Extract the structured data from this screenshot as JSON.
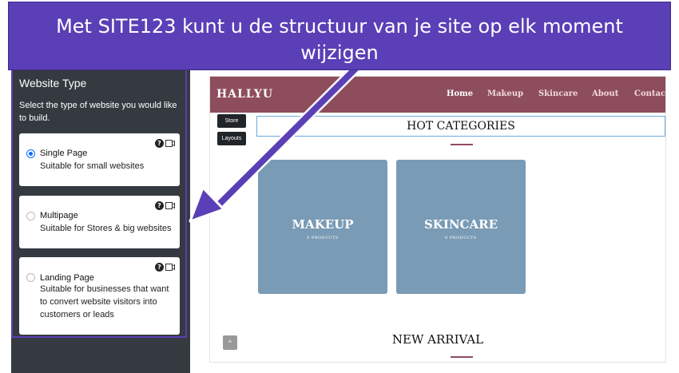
{
  "banner": {
    "line1": "Met SITE123 kunt u de structuur van je site op elk moment",
    "line2": "wijzigen"
  },
  "panel": {
    "title": "Website Type",
    "description": "Select the type of website you would like to build.",
    "options": [
      {
        "title": "Single Page",
        "description": "Suitable for small websites",
        "selected": true
      },
      {
        "title": "Multipage",
        "description": "Suitable for Stores & big websites",
        "selected": false
      },
      {
        "title": "Landing Page",
        "description": "Suitable for businesses that want to convert website visitors into customers or leads",
        "selected": false
      }
    ],
    "help_glyph": "?"
  },
  "site": {
    "logo": "HALLYU",
    "nav": [
      "Home",
      "Makeup",
      "Skincare",
      "About",
      "Contact"
    ],
    "side_buttons": [
      "Store",
      "Layouts"
    ],
    "hot_categories": "HOT CATEGORIES",
    "tiles": [
      {
        "name": "MAKEUP",
        "count": "0 PRODUCTS"
      },
      {
        "name": "SKINCARE",
        "count": "0 PRODUCTS"
      }
    ],
    "new_arrival": "NEW ARRIVAL",
    "scroll_top_glyph": "^"
  },
  "colors": {
    "banner": "#5b3fb6",
    "panel": "#343a40",
    "header": "#8e4d5c",
    "tile": "#7a9bb5",
    "radio_selected": "#0d6efd"
  }
}
